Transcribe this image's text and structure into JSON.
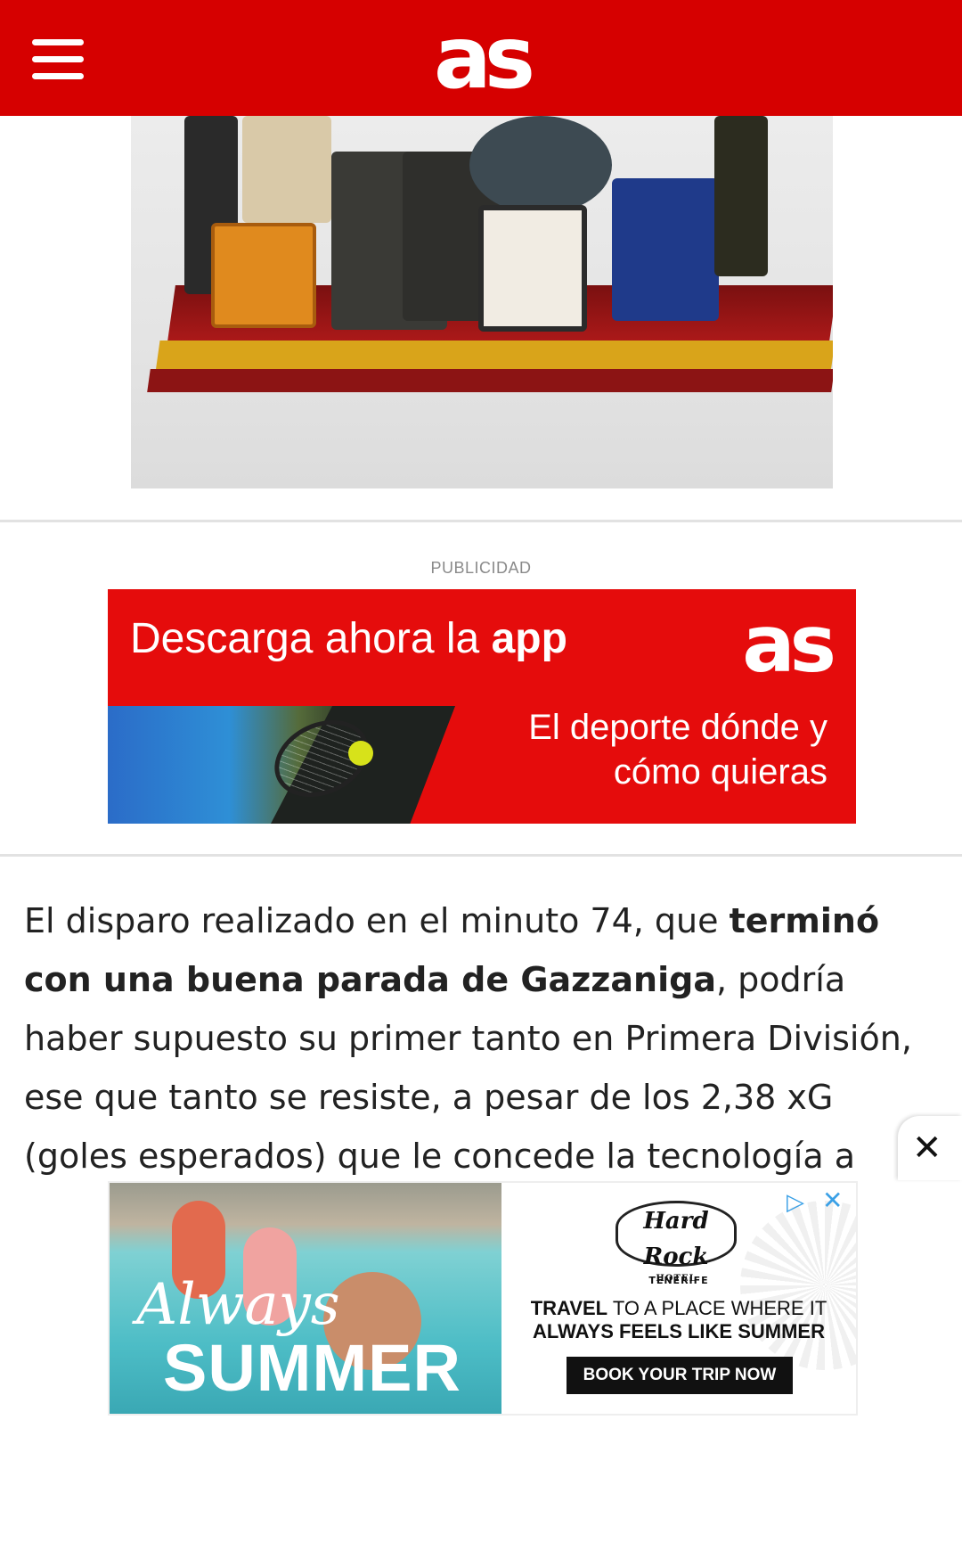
{
  "header": {
    "logo": "as",
    "menu_icon": "hamburger-menu-icon",
    "background_color": "#d60000"
  },
  "ad_label": "PUBLICIDAD",
  "app_banner": {
    "headline_prefix": "Descarga ahora la ",
    "headline_bold": "app",
    "logo": "as",
    "tagline_line1": "El deporte dónde y",
    "tagline_line2": "cómo quieras",
    "background_color": "#e50c0c"
  },
  "article": {
    "text_before": "El disparo realizado en el minuto 74, que ",
    "text_bold": "terminó con una buena parada de Gazzaniga",
    "text_after": ", podría haber supuesto su primer tanto en Primera División, ese que tanto se resiste, a pesar de los 2,38 xG (goles esperados) que le concede la tecnología a estas"
  },
  "bottom_ad": {
    "left_script": "Always",
    "left_title": "SUMMER",
    "brand_logo_text": "Hard Rock",
    "brand_logo_subtext": "HOTEL",
    "location": "TENERIFE",
    "tagline_bold1": "TRAVEL",
    "tagline_rest1": " TO A PLACE WHERE IT",
    "tagline_line2": "ALWAYS FEELS LIKE SUMMER",
    "cta": "BOOK YOUR TRIP NOW",
    "adchoices_icon": "adchoices-icon",
    "close_icon": "close-icon"
  },
  "sticky_close_icon": "close-icon"
}
